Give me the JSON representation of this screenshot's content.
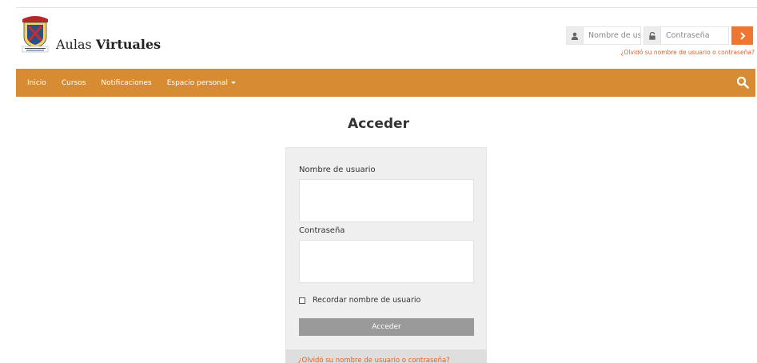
{
  "header": {
    "brand_regular": "Aulas",
    "brand_bold": "Virtuales",
    "logo_icon": "shield-crest-logo"
  },
  "top_login": {
    "username_placeholder": "Nombre de usuar",
    "password_placeholder": "Contraseña",
    "go_icon": "chevron-right-icon",
    "forgot_link": "¿Olvidó su nombre de usuario o contraseña?"
  },
  "nav": {
    "items": [
      {
        "label": "Inicio"
      },
      {
        "label": "Cursos"
      },
      {
        "label": "Notificaciones"
      },
      {
        "label": "Espacio personal"
      }
    ],
    "search_icon": "search-icon"
  },
  "main": {
    "title": "Acceder",
    "username_label": "Nombre de usuario",
    "password_label": "Contraseña",
    "remember_label": "Recordar nombre de usuario",
    "remember_checked": false,
    "submit_label": "Acceder",
    "forgot_link": "¿Olvidó su nombre de usuario o contraseña?"
  },
  "colors": {
    "nav_bg": "#d78b33",
    "accent_button": "#ef7630",
    "link": "#e0612a",
    "submit_bg": "#9a9a9a",
    "panel_bg": "#efefef"
  }
}
